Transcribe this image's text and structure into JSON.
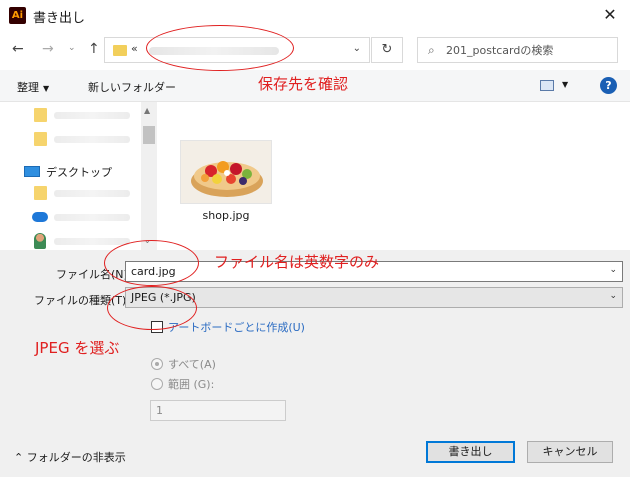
{
  "window": {
    "title": "書き出し",
    "app_icon_text": "Ai",
    "close_glyph": "✕"
  },
  "nav": {
    "back_glyph": "←",
    "forward_glyph": "→",
    "history_glyph": "⌄",
    "up_glyph": "↑",
    "refresh_glyph": "↻"
  },
  "address": {
    "separator": "«",
    "dropdown_glyph": "⌄"
  },
  "search": {
    "placeholder": "201_postcardの検索",
    "icon_glyph": "⌕"
  },
  "toolbar": {
    "organize_label": "整理",
    "organize_caret": "▼",
    "new_folder_label": "新しいフォルダー",
    "view_caret": "▼",
    "help_glyph": "?"
  },
  "nav_pane": {
    "desktop_label": "デスクトップ",
    "scroll_up": "▲",
    "scroll_down": "⌄"
  },
  "files": [
    {
      "name": "shop.jpg"
    }
  ],
  "form": {
    "filename_label": "ファイル名(N):",
    "filename_value": "card.jpg",
    "filetype_label": "ファイルの種類(T):",
    "filetype_value": "JPEG (*.JPG)",
    "artboard_label": "アートボードごとに作成(U)",
    "range_all_label": "すべて(A)",
    "range_custom_label": "範囲 (G):",
    "range_value": "1",
    "hide_folders_label": "フォルダーの非表示",
    "hide_folders_glyph": "⌃",
    "export_button": "書き出し",
    "cancel_button": "キャンセル",
    "dropdown_glyph": "⌄"
  },
  "annotations": {
    "save_location": "保存先を確認",
    "filename_note": "ファイル名は英数字のみ",
    "jpeg_note": "JPEG を選ぶ",
    "color": "#e02020"
  }
}
